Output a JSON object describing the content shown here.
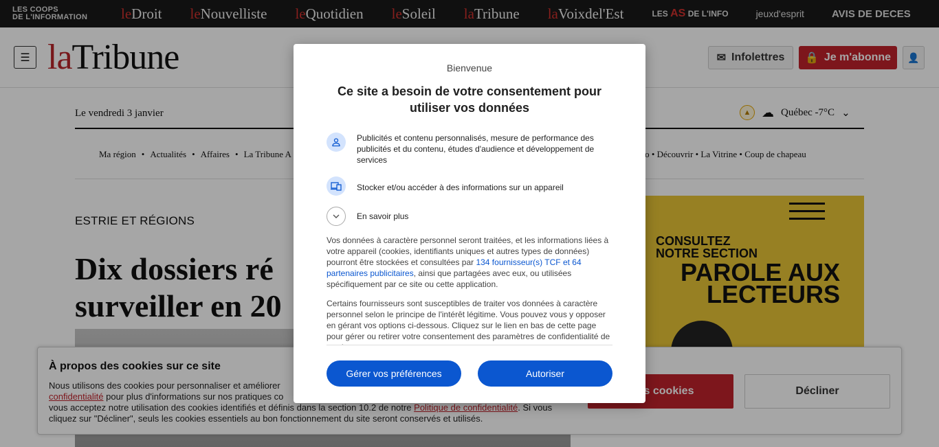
{
  "network": {
    "coops_line1": "LES COOPS",
    "coops_line2": "DE L'INFORMATION",
    "sites": [
      {
        "le": "le",
        "name": "Droit"
      },
      {
        "le": "le",
        "name": "Nouvelliste"
      },
      {
        "le": "le",
        "name": "Quotidien"
      },
      {
        "le": "le",
        "name": "Soleil"
      },
      {
        "le": "la",
        "name": "Tribune"
      },
      {
        "le": "la",
        "name": "Voixdel'Est"
      }
    ],
    "as_pre": "LES",
    "as_mid": "AS",
    "as_post": "DE L'INFO",
    "jeux": "jeuxd'esprit",
    "avis": "AVIS DE DECES"
  },
  "header": {
    "logo_la": "la",
    "logo_name": "Tribune",
    "infolettres": "Infolettres",
    "abonne": "Je m'abonne"
  },
  "page": {
    "date": "Le vendredi 3 janvier",
    "weather": "Québec -7°C",
    "nav_left": [
      "Ma région",
      "Actualités",
      "Affaires",
      "La Tribune A"
    ],
    "nav_right": "nto  •  Découvrir  •  La Vitrine  •  Coup de chapeau",
    "section": "ESTRIE ET RÉGIONS",
    "headline_1": "Dix dossiers ré",
    "headline_2": "surveiller en 20",
    "ad_line1": "CONSULTEZ",
    "ad_line2": "NOTRE SECTION",
    "ad_big1": "PAROLE AUX",
    "ad_big2": "LECTEURS"
  },
  "cookie": {
    "title": "À propos des cookies sur ce site",
    "text_1": "Nous utilisons des cookies pour personnaliser et améliorer",
    "link_1": "confidentialité",
    "text_2": " pour plus d'informations sur nos pratiques co",
    "text_3": "vous acceptez notre utilisation des cookies identifiés et définis dans la section 10.2 de notre ",
    "link_2": "Politique de confidentialité",
    "text_4": ". Si vous cliquez sur \"Décliner\", seuls les cookies essentiels au bon fonctionnement du site seront conservés et utilisés.",
    "accept": "r les cookies",
    "decline": "Décliner"
  },
  "consent": {
    "welcome": "Bienvenue",
    "title": "Ce site a besoin de votre consentement pour utiliser vos données",
    "purpose_1": "Publicités et contenu personnalisés, mesure de performance des publicités et du contenu, études d'audience et développement de services",
    "purpose_2": "Stocker et/ou accéder à des informations sur un appareil",
    "learn_more": "En savoir plus",
    "para_1a": "Vos données à caractère personnel seront traitées, et les informations liées à votre appareil (cookies, identifiants uniques et autres types de données) pourront être stockées et consultées par ",
    "para_1_link": "134 fournisseur(s) TCF et 64 partenaires publicitaires",
    "para_1b": ", ainsi que partagées avec eux, ou utilisées spécifiquement par ce site ou cette application.",
    "para_2": "Certains fournisseurs sont susceptibles de traiter vos données à caractère personnel selon le principe de l'intérêt légitime. Vous pouvez vous y opposer en gérant vos options ci-dessous. Cliquez sur le lien en bas de cette page pour gérer ou retirer votre consentement des paramètres de confidentialité de ce site.",
    "btn_manage": "Gérer vos préférences",
    "btn_allow": "Autoriser"
  }
}
